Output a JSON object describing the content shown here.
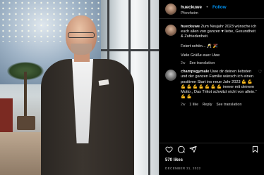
{
  "header": {
    "username": "hueckuwe",
    "separator": "•",
    "follow_label": "Follow",
    "location": "Pforzheim"
  },
  "caption": {
    "username": "hueckuwe",
    "text": "Zum Neujahr 2023 wünsche ich euch allen von ganzen ♥ liebe, Gesundheit & Zufriedenheit.",
    "line2": "Feiert schön... 🥂 🎉",
    "line3": "Viele Grüße euer Uwe",
    "time": "2w",
    "translate_label": "See translation"
  },
  "comment": {
    "username": "champsgymale",
    "text": "Uwe dir deinen liebsten und der ganzen Familie wünsch ich einen positiven Start ins neue Jahr 2023 💪 💪 💪 💪 💪 💪 💪 💪 💪 immer mit deinem Motto „ Das Trikot schwitzt nicht von allein.“ 💪 💪",
    "time": "2w",
    "likes_label": "1 like",
    "reply_label": "Reply",
    "translate_label": "See translation",
    "heart_icon": "heart-outline-icon"
  },
  "actions": {
    "icons": [
      "heart-icon",
      "comment-icon",
      "share-icon",
      "bookmark-icon"
    ]
  },
  "likes_text": "570 likes",
  "date_text": "DECEMBER 31, 2022",
  "colors": {
    "background": "#000000",
    "text": "#f5f5f5",
    "secondary": "#a8a8a8",
    "follow": "#0095f6"
  }
}
